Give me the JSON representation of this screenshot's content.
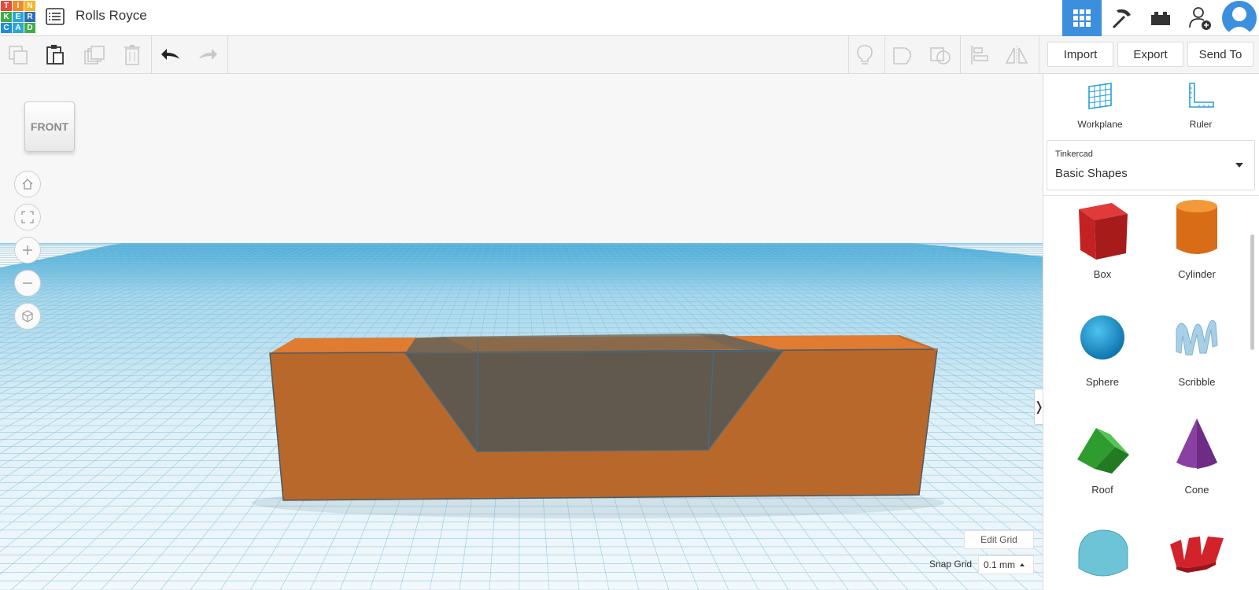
{
  "app": {
    "logo_letters": [
      "T",
      "I",
      "N",
      "K",
      "E",
      "R",
      "C",
      "A",
      "D"
    ],
    "project_title": "Rolls Royce",
    "top_icons": [
      "grid-view-icon",
      "pickaxe-icon",
      "bricks-icon",
      "add-user-icon",
      "avatar-icon"
    ]
  },
  "toolbar": {
    "import_label": "Import",
    "export_label": "Export",
    "send_to_label": "Send To"
  },
  "viewport": {
    "viewcube_label": "FRONT",
    "edit_grid_label": "Edit Grid",
    "snap_grid_label": "Snap Grid",
    "snap_grid_value": "0.1 mm",
    "collapse_glyph": "❭"
  },
  "panel": {
    "workplane_label": "Workplane",
    "ruler_label": "Ruler",
    "library_small": "Tinkercad",
    "library_name": "Basic Shapes",
    "shapes": [
      {
        "label": "Box",
        "color": "#d62b2b"
      },
      {
        "label": "Cylinder",
        "color": "#e37c1d"
      },
      {
        "label": "Sphere",
        "color": "#1a9bd7"
      },
      {
        "label": "Scribble",
        "color": "#a7cfe6"
      },
      {
        "label": "Roof",
        "color": "#3fae3f"
      },
      {
        "label": "Cone",
        "color": "#8a3fa3"
      },
      {
        "label": "",
        "color": "#6cc4d6"
      },
      {
        "label": "",
        "color": "#d2232a"
      }
    ]
  },
  "colors": {
    "accent": "#3c8fdd",
    "object_orange": "#b8682a",
    "object_top": "#e07b32",
    "hole_gray": "#5a5850",
    "grid_blue": "#7ec8e3"
  }
}
